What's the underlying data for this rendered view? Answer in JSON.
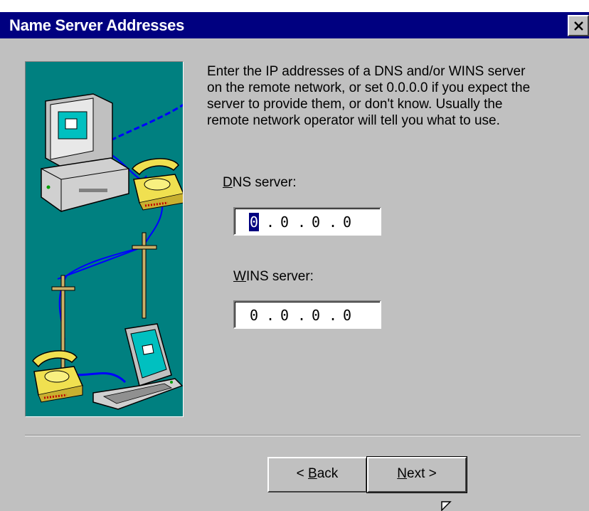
{
  "window": {
    "title": "Name Server Addresses",
    "close_icon": "close-x-icon"
  },
  "description": [
    "Enter the IP addresses of a DNS and/or WINS server",
    "on the remote network, or set 0.0.0.0 if you expect the",
    "server to provide them, or don't know.  Usually the",
    "remote network operator will tell you what to use."
  ],
  "dns": {
    "label_accel": "D",
    "label_rest": "NS server:",
    "octets": [
      "0",
      "0",
      "0",
      "0"
    ]
  },
  "wins": {
    "label_accel": "W",
    "label_rest": "INS server:",
    "octets": [
      "0",
      "0",
      "0",
      "0"
    ]
  },
  "buttons": {
    "back_prefix": "< ",
    "back_accel": "B",
    "back_rest": "ack",
    "next_accel": "N",
    "next_rest": "ext >"
  },
  "illustration": {
    "icons": [
      "desktop-computer-icon",
      "telephone-icon",
      "utility-pole-icon",
      "laptop-computer-icon"
    ]
  },
  "colors": {
    "title_bar": "#000080",
    "face": "#c0c0c0",
    "art_background": "#008080"
  }
}
